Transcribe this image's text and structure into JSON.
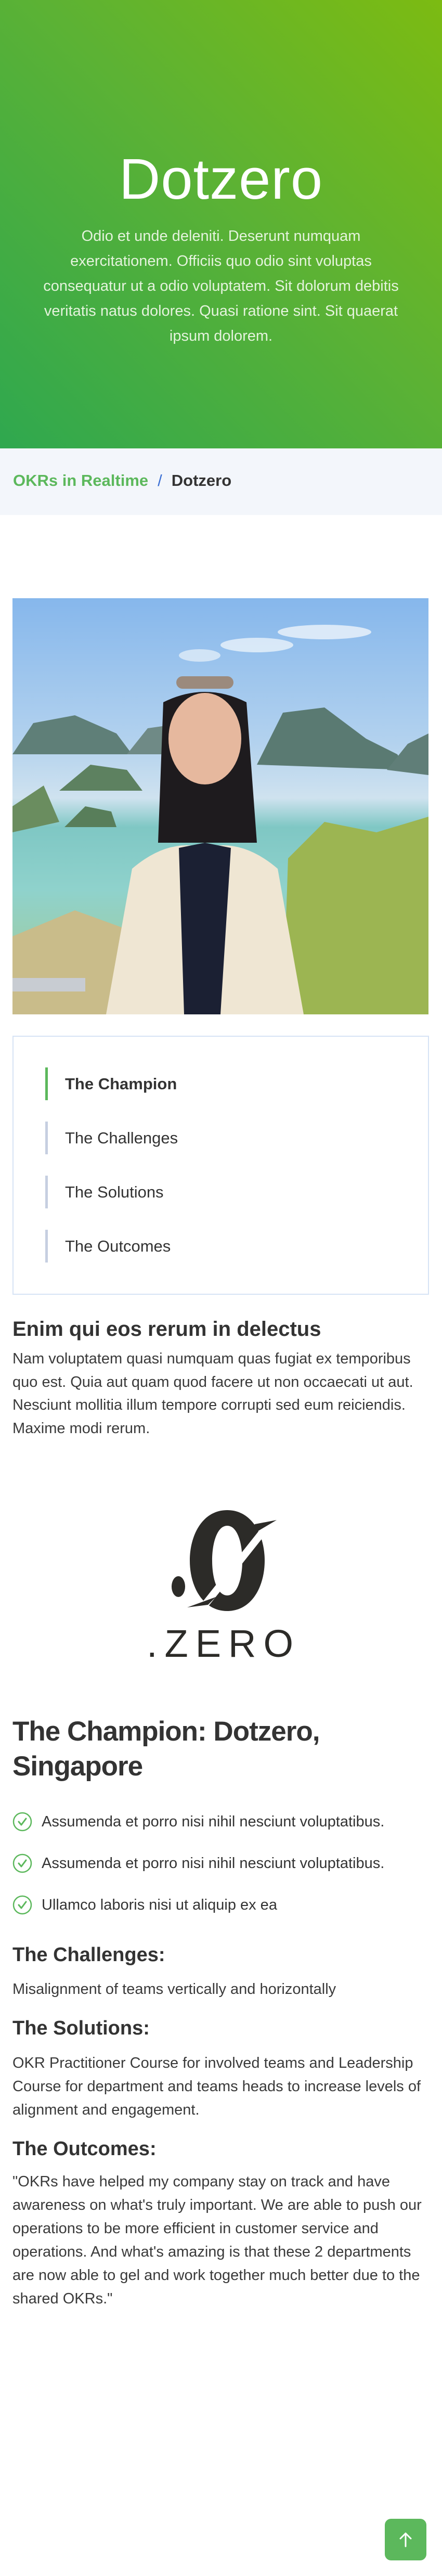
{
  "hero": {
    "title": "Dotzero",
    "text": "Odio et unde deleniti. Deserunt numquam exercitationem. Officiis quo odio sint voluptas consequatur ut a odio voluptatem. Sit dolorum debitis veritatis natus dolores. Quasi ratione sint. Sit quaerat ipsum dolorem."
  },
  "breadcrumb": {
    "parent": "OKRs in Realtime",
    "separator": "/",
    "current": "Dotzero"
  },
  "toc": {
    "items": [
      {
        "label": "The Champion",
        "active": true
      },
      {
        "label": "The Challenges",
        "active": false
      },
      {
        "label": "The Solutions",
        "active": false
      },
      {
        "label": "The Outcomes",
        "active": false
      }
    ]
  },
  "intro": {
    "heading": "Enim qui eos rerum in delectus",
    "text": "Nam voluptatem quasi numquam quas fugiat ex temporibus quo est. Quia aut quam quod facere ut non occaecati ut aut. Nesciunt mollitia illum tempore corrupti sed eum reiciendis. Maxime modi rerum."
  },
  "logo": {
    "text": ".ZERO"
  },
  "champion": {
    "heading": "The Champion: Dotzero, Singapore",
    "checklist": [
      "Assumenda et porro nisi nihil nesciunt voluptatibus.",
      "Assumenda et porro nisi nihil nesciunt voluptatibus.",
      "Ullamco laboris nisi ut aliquip ex ea"
    ]
  },
  "challenges": {
    "heading": "The Challenges:",
    "text": "Misalignment of teams vertically and horizontally"
  },
  "solutions": {
    "heading": "The Solutions:",
    "text": "OKR Practitioner Course for involved teams and Leadership Course for department and teams heads to increase levels of alignment and engagement."
  },
  "outcomes": {
    "heading": "The Outcomes:",
    "text": "\"OKRs have helped my company stay on track and have awareness on what's truly important. We are able to push our operations to be more efficient in customer service and operations. And what's amazing is that these 2 departments are now able to gel and work together much better due to the shared OKRs.\""
  },
  "colors": {
    "accent": "#5cb85c",
    "separator": "#3b6fd4",
    "hero_start": "#2fa84f",
    "hero_end": "#7cbb12"
  },
  "back_to_top": {
    "icon": "arrow-up-icon"
  }
}
